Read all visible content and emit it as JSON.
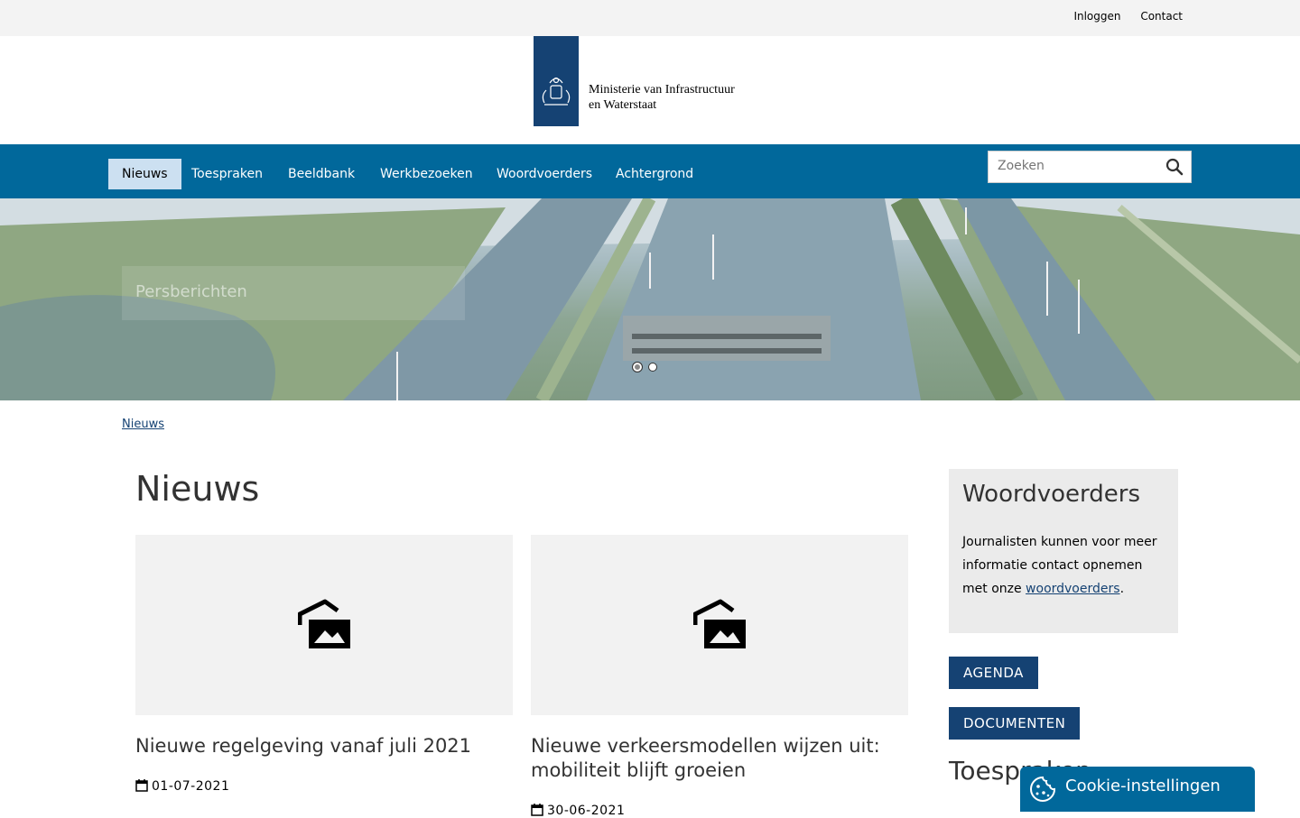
{
  "topbar": {
    "login": "Inloggen",
    "contact": "Contact"
  },
  "logo": {
    "line1": "Ministerie van Infrastructuur",
    "line2": "en Waterstaat"
  },
  "nav": {
    "items": [
      "Nieuws",
      "Toespraken",
      "Beeldbank",
      "Werkbezoeken",
      "Woordvoerders",
      "Achtergrond"
    ],
    "active": "Nieuws",
    "search_placeholder": "Zoeken"
  },
  "hero": {
    "caption": "Persberichten",
    "slides": 2,
    "active_slide": 1
  },
  "breadcrumb": "Nieuws",
  "main": {
    "title": "Nieuws",
    "cards": [
      {
        "title": "Nieuwe regelgeving vanaf juli 2021",
        "date": "01-07-2021"
      },
      {
        "title": "Nieuwe verkeersmodellen wijzen uit: mobiliteit blijft groeien",
        "date": "30-06-2021"
      }
    ]
  },
  "sidebar": {
    "box_title": "Woordvoerders",
    "box_text": "Journalisten kunnen voor meer informatie contact opnemen met onze ",
    "box_link": "woordvoerders",
    "box_suffix": ".",
    "buttons": [
      "AGENDA",
      "DOCUMENTEN"
    ],
    "next_heading": "Toespraken"
  },
  "cookie": {
    "label": "Cookie-instellingen"
  },
  "colors": {
    "brand": "#154273",
    "nav": "#01689b",
    "nav_active": "#cce0f1"
  }
}
